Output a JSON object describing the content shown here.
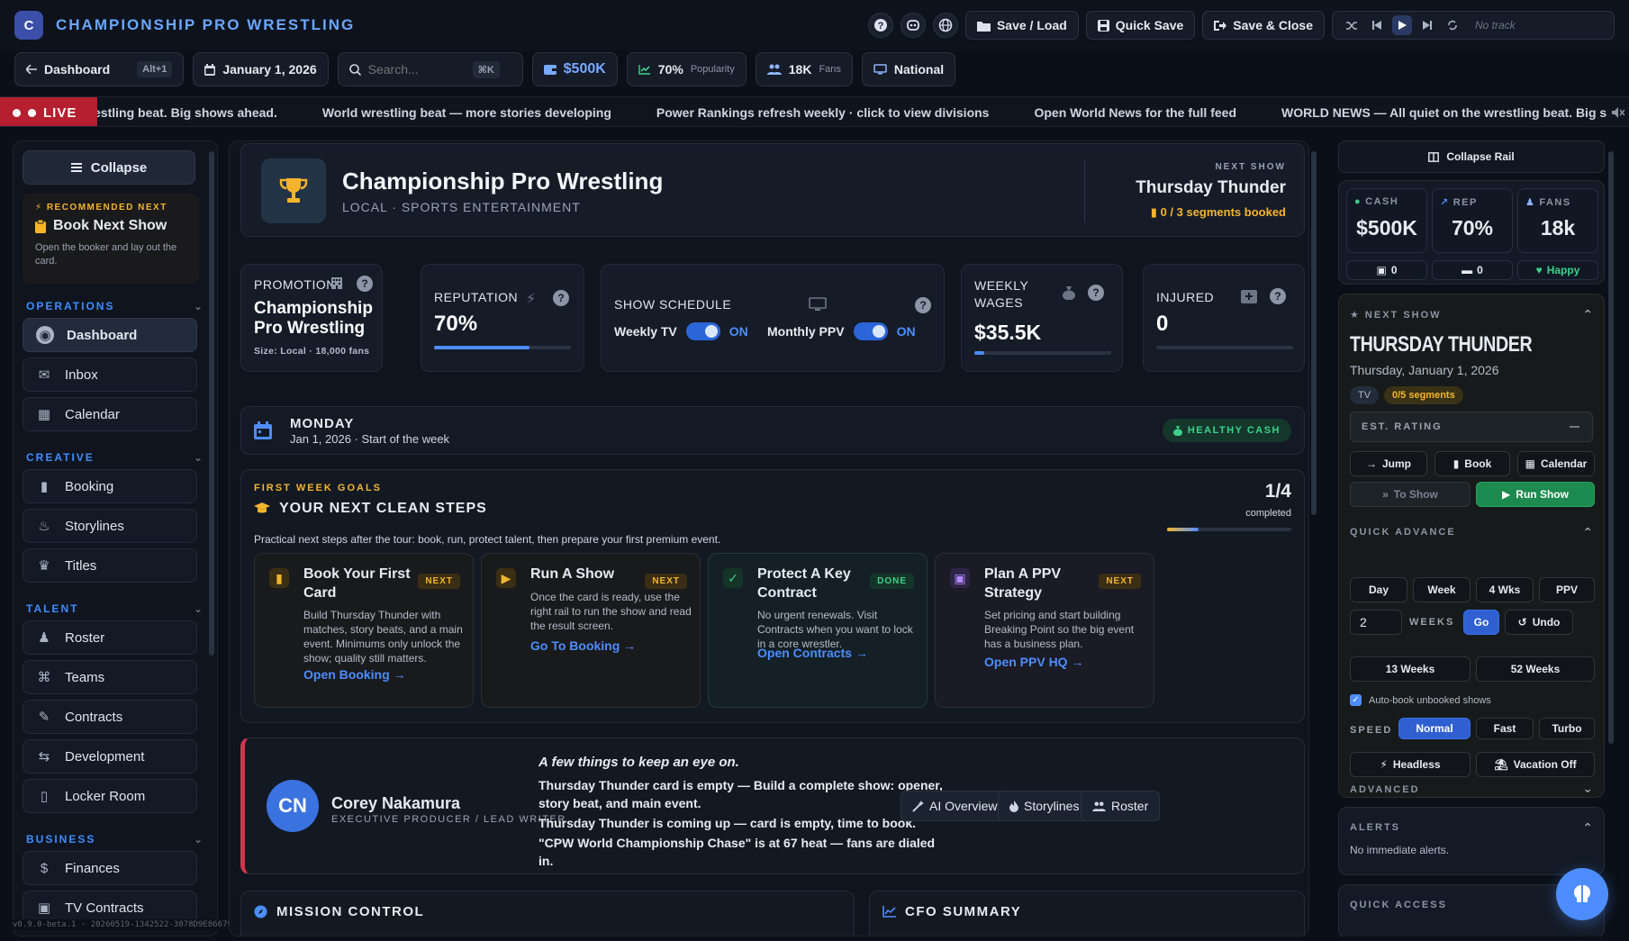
{
  "app": {
    "logo_letter": "C",
    "title": "CHAMPIONSHIP PRO WRESTLING",
    "version": "v0.9.0-beta.1 · 20260519-1342522-3078D9E86679"
  },
  "topbar": {
    "icon_buttons": [
      "help-icon",
      "discord-icon",
      "globe-icon"
    ],
    "save_load": "Save / Load",
    "quick_save": "Quick Save",
    "save_close": "Save & Close",
    "player": {
      "track": "No track"
    }
  },
  "chips": {
    "dashboard": "Dashboard",
    "dashboard_kbd": "Alt+1",
    "date": "January 1, 2026",
    "search_placeholder": "Search...",
    "search_kbd": "⌘K",
    "cash": "$500K",
    "popularity": "70%",
    "popularity_label": "Popularity",
    "fans": "18K",
    "fans_label": "Fans",
    "reach": "National"
  },
  "ticker": {
    "live": "LIVE",
    "items": [
      "e wrestling beat. Big shows ahead.",
      "World wrestling beat — more stories developing",
      "Power Rankings refresh weekly · click to view divisions",
      "Open World News for the full feed",
      "WORLD NEWS — All quiet on the wrestling beat. Big shows ahead."
    ]
  },
  "sidebar": {
    "collapse": "Collapse",
    "recommended": {
      "tag": "RECOMMENDED NEXT",
      "title": "Book Next Show",
      "desc": "Open the booker and lay out the card."
    },
    "sections": [
      {
        "title": "OPERATIONS",
        "items": [
          "Dashboard",
          "Inbox",
          "Calendar"
        ]
      },
      {
        "title": "CREATIVE",
        "items": [
          "Booking",
          "Storylines",
          "Titles"
        ]
      },
      {
        "title": "TALENT",
        "items": [
          "Roster",
          "Teams",
          "Contracts",
          "Development",
          "Locker Room"
        ]
      },
      {
        "title": "BUSINESS",
        "items": [
          "Finances",
          "TV Contracts"
        ]
      }
    ]
  },
  "hero": {
    "name": "Championship Pro Wrestling",
    "subtitle": "LOCAL · SPORTS ENTERTAINMENT",
    "next_show_tag": "NEXT SHOW",
    "next_show": "Thursday Thunder",
    "segments": "0 / 3 segments booked"
  },
  "stats": {
    "promotion": {
      "label": "PROMOTION",
      "name": "Championship Pro Wrestling",
      "size": "Size: Local · 18,000 fans"
    },
    "reputation": {
      "label": "REPUTATION",
      "value": "70%",
      "fill": 0.7
    },
    "schedule": {
      "label": "SHOW SCHEDULE",
      "weekly": "Weekly TV",
      "weekly_state": "ON",
      "monthly": "Monthly PPV",
      "monthly_state": "ON"
    },
    "wages": {
      "label": "WEEKLY WAGES",
      "value": "$35.5K",
      "fill": 0.07
    },
    "injured": {
      "label": "INJURED",
      "value": "0",
      "fill": 0
    }
  },
  "day": {
    "name": "MONDAY",
    "sub": "Jan 1, 2026 · Start of the week",
    "badge": "HEALTHY CASH"
  },
  "goals": {
    "tag": "FIRST WEEK GOALS",
    "title": "YOUR NEXT CLEAN STEPS",
    "desc": "Practical next steps after the tour: book, run, protect talent, then prepare your first premium event.",
    "count": "1/4",
    "count_label": "completed",
    "progress": 0.25,
    "items": [
      {
        "title": "Book Your First Card",
        "badge": "NEXT",
        "desc": "Build Thursday Thunder with matches, story beats, and a main event. Minimums only unlock the show; quality still matters.",
        "link": "Open Booking →"
      },
      {
        "title": "Run A Show",
        "badge": "NEXT",
        "desc": "Once the card is ready, use the right rail to run the show and read the result screen.",
        "link": "Go To Booking →"
      },
      {
        "title": "Protect A Key Contract",
        "badge": "DONE",
        "desc": "No urgent renewals. Visit Contracts when you want to lock in a core wrestler.",
        "link": "Open Contracts →"
      },
      {
        "title": "Plan A PPV Strategy",
        "badge": "NEXT",
        "desc": "Set pricing and start building Breaking Point so the big event has a business plan.",
        "link": "Open PPV HQ →"
      }
    ]
  },
  "producer": {
    "initials": "CN",
    "name": "Corey Nakamura",
    "role": "EXECUTIVE PRODUCER / LEAD WRITER",
    "headline": "A few things to keep an eye on.",
    "lines": [
      "Thursday Thunder card is empty — Build a complete show: opener, story beat, and main event.",
      "Thursday Thunder is coming up — card is empty, time to book.",
      "\"CPW World Championship Chase\" is at 67 heat — fans are dialed in."
    ],
    "buttons": [
      "AI Overview",
      "Storylines",
      "Roster"
    ]
  },
  "bottom": {
    "mission": "MISSION CONTROL",
    "cfo": "CFO SUMMARY"
  },
  "rail": {
    "collapse": "Collapse Rail",
    "cash_label": "CASH",
    "cash": "$500K",
    "rep_label": "REP",
    "rep": "70%",
    "fans_label": "FANS",
    "fans": "18k",
    "sub1": "0",
    "sub2": "0",
    "sub3": "Happy",
    "next_tag": "NEXT SHOW",
    "show_name": "THURSDAY THUNDER",
    "show_date": "Thursday, January 1, 2026",
    "tv": "TV",
    "segments": "0/5 segments",
    "est_rating": "EST. RATING",
    "est_value": "—",
    "jump": "Jump",
    "book": "Book",
    "calendar": "Calendar",
    "to_show": "To Show",
    "run_show": "Run Show",
    "quick_advance": "QUICK ADVANCE",
    "day": "Day",
    "week": "Week",
    "four_weeks": "4 Wks",
    "ppv": "PPV",
    "weeks_value": "2",
    "weeks_label": "WEEKS",
    "go": "Go",
    "undo": "Undo",
    "w13": "13 Weeks",
    "w52": "52 Weeks",
    "auto_book": "Auto-book unbooked shows",
    "speed_label": "SPEED",
    "speed_options": [
      "Normal",
      "Fast",
      "Turbo"
    ],
    "speed_selected": "Normal",
    "headless": "Headless",
    "vacation": "Vacation Off",
    "advanced": "ADVANCED",
    "alerts_tag": "ALERTS",
    "alerts_text": "No immediate alerts.",
    "quick_access": "QUICK ACCESS"
  },
  "colors": {
    "accent": "#4d8dff",
    "gold": "#f4b52c",
    "green": "#3dd18a",
    "live_red": "#b51f2f"
  }
}
